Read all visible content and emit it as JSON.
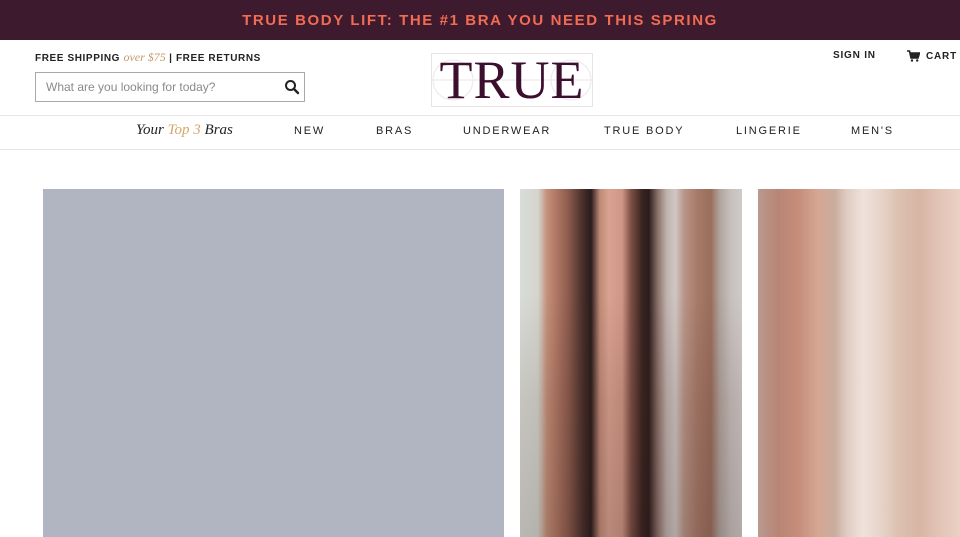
{
  "promo": {
    "text": "TRUE BODY LIFT: THE #1 BRA YOU NEED THIS SPRING"
  },
  "header": {
    "shipping_free_label": "FREE SHIPPING",
    "shipping_threshold": "over $75",
    "shipping_separator": "|",
    "shipping_returns_label": "FREE RETURNS",
    "logo_text": "TRUE",
    "sign_in": "SIGN IN",
    "cart": "CART (",
    "search": {
      "placeholder": "What are you looking for today?",
      "value": ""
    }
  },
  "nav": {
    "feature": {
      "prefix": "Your",
      "accent": "Top 3",
      "suffix": "Bras"
    },
    "items": [
      "NEW",
      "BRAS",
      "UNDERWEAR",
      "TRUE BODY",
      "LINGERIE",
      "MEN'S"
    ]
  },
  "icons": {
    "search": "magnifier-icon",
    "cart": "cart-icon"
  },
  "colors": {
    "promo_background": "#3d1a2e",
    "promo_text": "#f26b52",
    "logo": "#3d0f2e",
    "accent_gold": "#c4996b",
    "tile_placeholder": "#b1b5c2"
  }
}
